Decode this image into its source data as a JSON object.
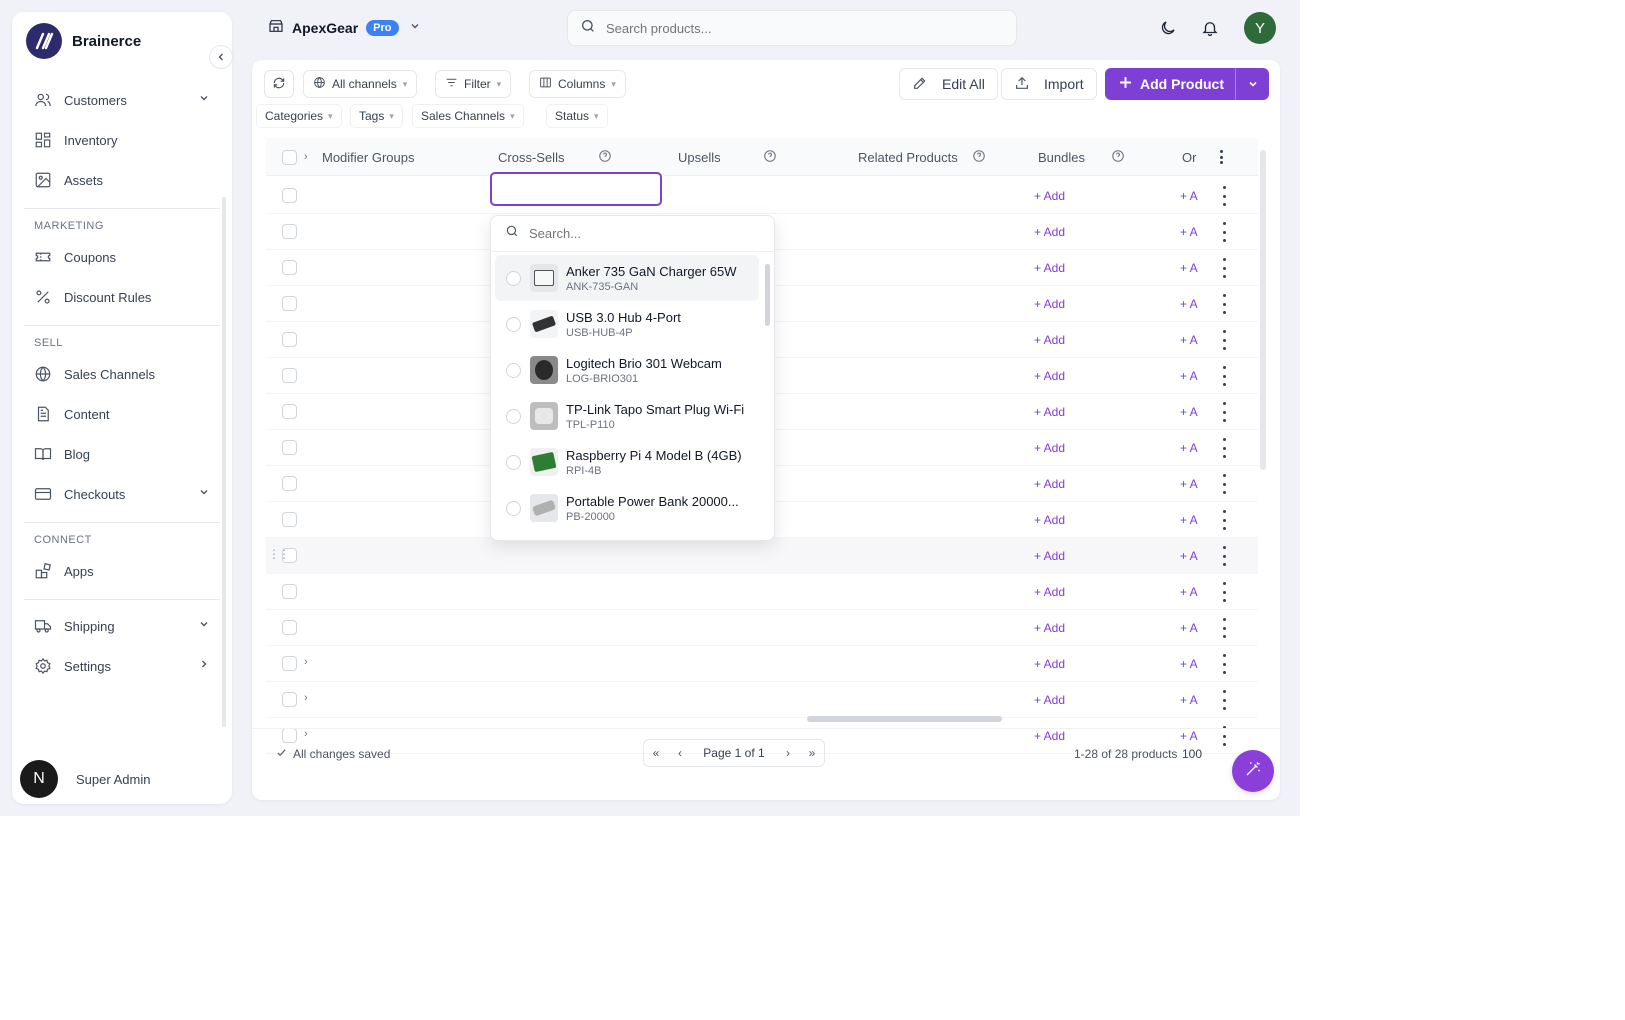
{
  "brand": {
    "name": "Brainerce"
  },
  "sidebar": {
    "items_top": [
      {
        "label": "Customers",
        "icon": "users-icon",
        "chevron": "down"
      },
      {
        "label": "Inventory",
        "icon": "grid-icon"
      },
      {
        "label": "Assets",
        "icon": "image-icon"
      }
    ],
    "sections": [
      {
        "title": "MARKETING",
        "items": [
          {
            "label": "Coupons",
            "icon": "ticket-icon"
          },
          {
            "label": "Discount Rules",
            "icon": "percent-icon"
          }
        ]
      },
      {
        "title": "SELL",
        "items": [
          {
            "label": "Sales Channels",
            "icon": "globe-icon"
          },
          {
            "label": "Content",
            "icon": "document-icon"
          },
          {
            "label": "Blog",
            "icon": "book-icon"
          },
          {
            "label": "Checkouts",
            "icon": "card-icon",
            "chevron": "down"
          }
        ]
      },
      {
        "title": "CONNECT",
        "items": [
          {
            "label": "Apps",
            "icon": "apps-icon"
          }
        ]
      }
    ],
    "items_bottom": [
      {
        "label": "Shipping",
        "icon": "truck-icon",
        "chevron": "down"
      },
      {
        "label": "Settings",
        "icon": "gear-icon",
        "chevron": "right"
      }
    ],
    "user": {
      "initial": "N",
      "name": "Super Admin"
    }
  },
  "topbar": {
    "store_name": "ApexGear",
    "badge": "Pro",
    "search_placeholder": "Search products...",
    "avatar_initial": "Y"
  },
  "toolbar": {
    "channels": "All channels",
    "filter": "Filter",
    "columns": "Columns",
    "edit_all": "Edit All",
    "import": "Import",
    "add_product": "Add Product"
  },
  "chips": [
    "Categories",
    "Tags",
    "Sales Channels",
    "Status"
  ],
  "table": {
    "headers": {
      "modifier_groups": "Modifier Groups",
      "cross_sells": "Cross-Sells",
      "upsells": "Upsells",
      "related": "Related Products",
      "bundles": "Bundles",
      "order": "Or"
    },
    "add_label": "+ Add",
    "add_label_short": "+ A"
  },
  "dropdown": {
    "search_placeholder": "Search...",
    "items": [
      {
        "name": "Anker 735 GaN Charger 65W",
        "sku": "ANK-735-GAN"
      },
      {
        "name": "USB 3.0 Hub 4-Port",
        "sku": "USB-HUB-4P"
      },
      {
        "name": "Logitech Brio 301 Webcam",
        "sku": "LOG-BRIO301"
      },
      {
        "name": "TP-Link Tapo Smart Plug Wi-Fi",
        "sku": "TPL-P110"
      },
      {
        "name": "Raspberry Pi 4 Model B (4GB)",
        "sku": "RPI-4B"
      },
      {
        "name": "Portable Power Bank 20000...",
        "sku": "PB-20000"
      }
    ]
  },
  "footer": {
    "saved": "All changes saved",
    "page": "Page 1 of 1",
    "count": "1-28 of 28 products",
    "per_page": "100"
  },
  "colors": {
    "accent": "#7e3fd4",
    "pro_badge": "#3b82f6",
    "avatar": "#2f6b3a"
  }
}
